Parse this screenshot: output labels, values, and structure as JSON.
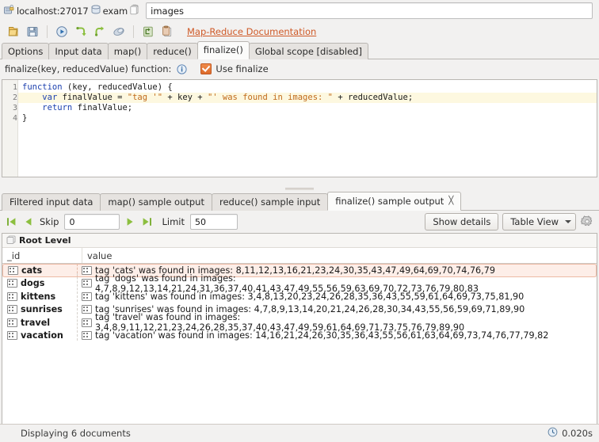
{
  "connection": {
    "host": "localhost:27017",
    "database": "exam",
    "collection": "images",
    "host_icon": "server-lock-icon",
    "db_icon": "database-icon",
    "collection_icon": "collection-icon"
  },
  "toolbar": {
    "buttons": [
      {
        "name": "open-icon",
        "label": "Open"
      },
      {
        "name": "save-icon",
        "label": "Save"
      },
      {
        "name": "run-icon",
        "label": "Run"
      },
      {
        "name": "step-into-icon",
        "label": "Step into"
      },
      {
        "name": "step-over-icon",
        "label": "Step over"
      },
      {
        "name": "clear-icon",
        "label": "Clear"
      },
      {
        "name": "paste-into-shell-icon",
        "label": "Paste into shell"
      },
      {
        "name": "copy-icon",
        "label": "Copy"
      }
    ],
    "doc_link": "Map-Reduce Documentation"
  },
  "main_tabs": [
    {
      "label": "Options",
      "selected": false
    },
    {
      "label": "Input data",
      "selected": false
    },
    {
      "label": "map()",
      "selected": false
    },
    {
      "label": "reduce()",
      "selected": false
    },
    {
      "label": "finalize()",
      "selected": true
    },
    {
      "label": "Global scope [disabled]",
      "selected": false
    }
  ],
  "editor": {
    "function_label": "finalize(key, reducedValue) function:",
    "info_icon": "info-icon",
    "use_finalize_label": "Use finalize",
    "use_finalize_checked": true,
    "lines": [
      {
        "number": "1",
        "highlighted": false,
        "tokens": [
          {
            "t": "function ",
            "c": "kw"
          },
          {
            "t": "(key, reducedValue) {",
            "c": "plain"
          }
        ]
      },
      {
        "number": "2",
        "highlighted": true,
        "tokens": [
          {
            "t": "    ",
            "c": "plain"
          },
          {
            "t": "var ",
            "c": "kw"
          },
          {
            "t": "finalValue = ",
            "c": "plain"
          },
          {
            "t": "\"tag '\"",
            "c": "str"
          },
          {
            "t": " + key + ",
            "c": "plain"
          },
          {
            "t": "\"' was found in images: \"",
            "c": "str"
          },
          {
            "t": " + reducedValue;",
            "c": "plain"
          }
        ]
      },
      {
        "number": "3",
        "highlighted": false,
        "tokens": [
          {
            "t": "    ",
            "c": "plain"
          },
          {
            "t": "return ",
            "c": "kw"
          },
          {
            "t": "finalValue;",
            "c": "plain"
          }
        ]
      },
      {
        "number": "4",
        "highlighted": false,
        "tokens": [
          {
            "t": "}",
            "c": "plain"
          }
        ]
      }
    ]
  },
  "result_tabs": [
    {
      "label": "Filtered input data",
      "selected": false,
      "closable": false
    },
    {
      "label": "map() sample output",
      "selected": false,
      "closable": false
    },
    {
      "label": "reduce() sample input",
      "selected": false,
      "closable": false
    },
    {
      "label": "finalize() sample output",
      "selected": true,
      "closable": true
    }
  ],
  "pager": {
    "first_icon": "first-page-icon",
    "prev_icon": "previous-page-icon",
    "next_icon": "next-page-icon",
    "last_icon": "last-page-icon",
    "skip_label": "Skip",
    "skip_value": "0",
    "limit_label": "Limit",
    "limit_value": "50",
    "show_details_label": "Show details",
    "view_mode_label": "Table View",
    "settings_icon": "gear-icon"
  },
  "results": {
    "root_label": "Root Level",
    "root_icon": "documents-icon",
    "columns": [
      "_id",
      "value"
    ],
    "rows": [
      {
        "id": "cats",
        "value": "tag 'cats' was found in images: 8,11,12,13,16,21,23,24,30,35,43,47,49,64,69,70,74,76,79",
        "selected": true
      },
      {
        "id": "dogs",
        "value": "tag 'dogs' was found in images: 4,7,8,9,12,13,14,21,24,31,36,37,40,41,43,47,49,55,56,59,63,69,70,72,73,76,79,80,83",
        "selected": false
      },
      {
        "id": "kittens",
        "value": "tag 'kittens' was found in images: 3,4,8,13,20,23,24,26,28,35,36,43,55,59,61,64,69,73,75,81,90",
        "selected": false
      },
      {
        "id": "sunrises",
        "value": "tag 'sunrises' was found in images: 4,7,8,9,13,14,20,21,24,26,28,30,34,43,55,56,59,69,71,89,90",
        "selected": false
      },
      {
        "id": "travel",
        "value": "tag 'travel' was found in images: 3,4,8,9,11,12,21,23,24,26,28,35,37,40,43,47,49,59,61,64,69,71,73,75,76,79,89,90",
        "selected": false
      },
      {
        "id": "vacation",
        "value": "tag 'vacation' was found in images: 14,16,21,24,26,30,35,36,43,55,56,61,63,64,69,73,74,76,77,79,82",
        "selected": false
      }
    ]
  },
  "status": {
    "text": "Displaying 6 documents",
    "elapsed": "0.020s",
    "clock_icon": "clock-icon"
  },
  "colors": {
    "accent": "#cf5a28",
    "selection": "#fdeee8",
    "code_highlight": "#fdf8e0",
    "keyword": "#1b3fae",
    "string": "#c06a1b"
  }
}
